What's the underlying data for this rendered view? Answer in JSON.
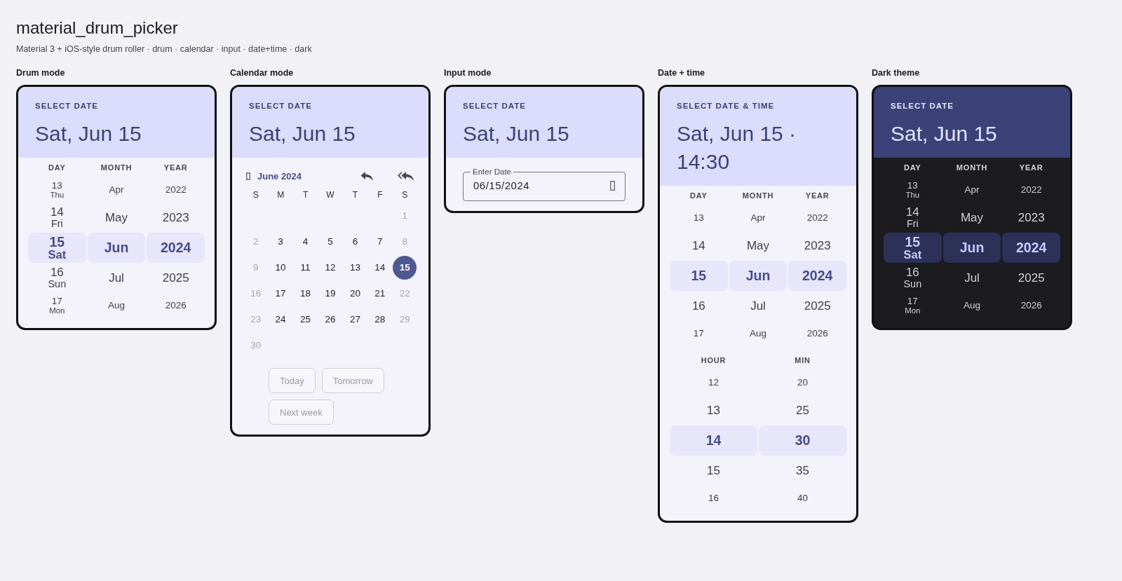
{
  "title": "material_drum_picker",
  "subtitle": "Material 3 + iOS-style drum roller · drum · calendar · input · date+time · dark",
  "pickers": [
    {
      "label": "Drum mode",
      "kind": "drum",
      "dark": false,
      "overline": "SELECT DATE",
      "headline": "Sat, Jun 15",
      "wheels": [
        {
          "heading": "DAY",
          "items": [
            {
              "text": "13",
              "sub": "Thu",
              "selected": false
            },
            {
              "text": "14",
              "sub": "Fri",
              "selected": false
            },
            {
              "text": "15",
              "sub": "Sat",
              "selected": true
            },
            {
              "text": "16",
              "sub": "Sun",
              "selected": false
            },
            {
              "text": "17",
              "sub": "Mon",
              "selected": false
            }
          ]
        },
        {
          "heading": "MONTH",
          "items": [
            {
              "text": "Apr",
              "selected": false
            },
            {
              "text": "May",
              "selected": false
            },
            {
              "text": "Jun",
              "selected": true
            },
            {
              "text": "Jul",
              "selected": false
            },
            {
              "text": "Aug",
              "selected": false
            }
          ]
        },
        {
          "heading": "YEAR",
          "items": [
            {
              "text": "2022",
              "selected": false
            },
            {
              "text": "2023",
              "selected": false
            },
            {
              "text": "2024",
              "selected": true
            },
            {
              "text": "2025",
              "selected": false
            },
            {
              "text": "2026",
              "selected": false
            }
          ]
        }
      ]
    },
    {
      "label": "Calendar mode",
      "kind": "calendar",
      "dark": false,
      "overline": "SELECT DATE",
      "headline": "Sat, Jun 15",
      "month": "June 2024",
      "weekdays": [
        "S",
        "M",
        "T",
        "W",
        "T",
        "F",
        "S"
      ],
      "weeks": [
        [
          {
            "kind": "blank"
          },
          {
            "kind": "blank"
          },
          {
            "kind": "blank"
          },
          {
            "kind": "blank"
          },
          {
            "kind": "blank"
          },
          {
            "kind": "blank"
          },
          {
            "kind": "day",
            "text": "1",
            "muted": true,
            "selected": false
          }
        ],
        [
          {
            "kind": "day",
            "text": "2",
            "muted": true,
            "selected": false
          },
          {
            "kind": "day",
            "text": "3",
            "muted": false,
            "selected": false
          },
          {
            "kind": "day",
            "text": "4",
            "muted": false,
            "selected": false
          },
          {
            "kind": "day",
            "text": "5",
            "muted": false,
            "selected": false
          },
          {
            "kind": "day",
            "text": "6",
            "muted": false,
            "selected": false
          },
          {
            "kind": "day",
            "text": "7",
            "muted": false,
            "selected": false
          },
          {
            "kind": "day",
            "text": "8",
            "muted": true,
            "selected": false
          }
        ],
        [
          {
            "kind": "day",
            "text": "9",
            "muted": true,
            "selected": false
          },
          {
            "kind": "day",
            "text": "10",
            "muted": false,
            "selected": false
          },
          {
            "kind": "day",
            "text": "11",
            "muted": false,
            "selected": false
          },
          {
            "kind": "day",
            "text": "12",
            "muted": false,
            "selected": false
          },
          {
            "kind": "day",
            "text": "13",
            "muted": false,
            "selected": false
          },
          {
            "kind": "day",
            "text": "14",
            "muted": false,
            "selected": false
          },
          {
            "kind": "day",
            "text": "15",
            "muted": false,
            "selected": true
          }
        ],
        [
          {
            "kind": "day",
            "text": "16",
            "muted": true,
            "selected": false
          },
          {
            "kind": "day",
            "text": "17",
            "muted": false,
            "selected": false
          },
          {
            "kind": "day",
            "text": "18",
            "muted": false,
            "selected": false
          },
          {
            "kind": "day",
            "text": "19",
            "muted": false,
            "selected": false
          },
          {
            "kind": "day",
            "text": "20",
            "muted": false,
            "selected": false
          },
          {
            "kind": "day",
            "text": "21",
            "muted": false,
            "selected": false
          },
          {
            "kind": "day",
            "text": "22",
            "muted": true,
            "selected": false
          }
        ],
        [
          {
            "kind": "day",
            "text": "23",
            "muted": true,
            "selected": false
          },
          {
            "kind": "day",
            "text": "24",
            "muted": false,
            "selected": false
          },
          {
            "kind": "day",
            "text": "25",
            "muted": false,
            "selected": false
          },
          {
            "kind": "day",
            "text": "26",
            "muted": false,
            "selected": false
          },
          {
            "kind": "day",
            "text": "27",
            "muted": false,
            "selected": false
          },
          {
            "kind": "day",
            "text": "28",
            "muted": false,
            "selected": false
          },
          {
            "kind": "day",
            "text": "29",
            "muted": true,
            "selected": false
          }
        ],
        [
          {
            "kind": "day",
            "text": "30",
            "muted": true,
            "selected": false
          },
          {
            "kind": "blank"
          },
          {
            "kind": "blank"
          },
          {
            "kind": "blank"
          },
          {
            "kind": "blank"
          },
          {
            "kind": "blank"
          },
          {
            "kind": "blank"
          }
        ]
      ],
      "shortcuts": [
        {
          "label": "Today",
          "disabled": true
        },
        {
          "label": "Tomorrow",
          "disabled": true
        },
        {
          "label": "Next week",
          "disabled": true
        }
      ]
    },
    {
      "label": "Input mode",
      "kind": "input",
      "dark": false,
      "overline": "SELECT DATE",
      "headline": "Sat, Jun 15",
      "field": {
        "label": "Enter Date",
        "value": "06/15/2024"
      }
    },
    {
      "label": "Date + time",
      "kind": "datetime",
      "dark": false,
      "overline": "SELECT DATE & TIME",
      "headline": "Sat, Jun 15 · 14:30",
      "wheels": [
        {
          "heading": "DAY",
          "items": [
            {
              "text": "13",
              "selected": false
            },
            {
              "text": "14",
              "selected": false
            },
            {
              "text": "15",
              "selected": true
            },
            {
              "text": "16",
              "selected": false
            },
            {
              "text": "17",
              "selected": false
            }
          ]
        },
        {
          "heading": "MONTH",
          "items": [
            {
              "text": "Apr",
              "selected": false
            },
            {
              "text": "May",
              "selected": false
            },
            {
              "text": "Jun",
              "selected": true
            },
            {
              "text": "Jul",
              "selected": false
            },
            {
              "text": "Aug",
              "selected": false
            }
          ]
        },
        {
          "heading": "YEAR",
          "items": [
            {
              "text": "2022",
              "selected": false
            },
            {
              "text": "2023",
              "selected": false
            },
            {
              "text": "2024",
              "selected": true
            },
            {
              "text": "2025",
              "selected": false
            },
            {
              "text": "2026",
              "selected": false
            }
          ]
        }
      ],
      "time_wheels": [
        {
          "heading": "HOUR",
          "items": [
            {
              "text": "12",
              "selected": false
            },
            {
              "text": "13",
              "selected": false
            },
            {
              "text": "14",
              "selected": true
            },
            {
              "text": "15",
              "selected": false
            },
            {
              "text": "16",
              "selected": false
            }
          ]
        },
        {
          "heading": "MIN",
          "items": [
            {
              "text": "20",
              "selected": false
            },
            {
              "text": "25",
              "selected": false
            },
            {
              "text": "30",
              "selected": true
            },
            {
              "text": "35",
              "selected": false
            },
            {
              "text": "40",
              "selected": false
            }
          ]
        }
      ]
    },
    {
      "label": "Dark theme",
      "kind": "drum",
      "dark": true,
      "overline": "SELECT DATE",
      "headline": "Sat, Jun 15",
      "wheels": [
        {
          "heading": "DAY",
          "items": [
            {
              "text": "13",
              "sub": "Thu",
              "selected": false
            },
            {
              "text": "14",
              "sub": "Fri",
              "selected": false
            },
            {
              "text": "15",
              "sub": "Sat",
              "selected": true
            },
            {
              "text": "16",
              "sub": "Sun",
              "selected": false
            },
            {
              "text": "17",
              "sub": "Mon",
              "selected": false
            }
          ]
        },
        {
          "heading": "MONTH",
          "items": [
            {
              "text": "Apr",
              "selected": false
            },
            {
              "text": "May",
              "selected": false
            },
            {
              "text": "Jun",
              "selected": true
            },
            {
              "text": "Jul",
              "selected": false
            },
            {
              "text": "Aug",
              "selected": false
            }
          ]
        },
        {
          "heading": "YEAR",
          "items": [
            {
              "text": "2022",
              "selected": false
            },
            {
              "text": "2023",
              "selected": false
            },
            {
              "text": "2024",
              "selected": true
            },
            {
              "text": "2025",
              "selected": false
            },
            {
              "text": "2026",
              "selected": false
            }
          ]
        }
      ]
    }
  ]
}
